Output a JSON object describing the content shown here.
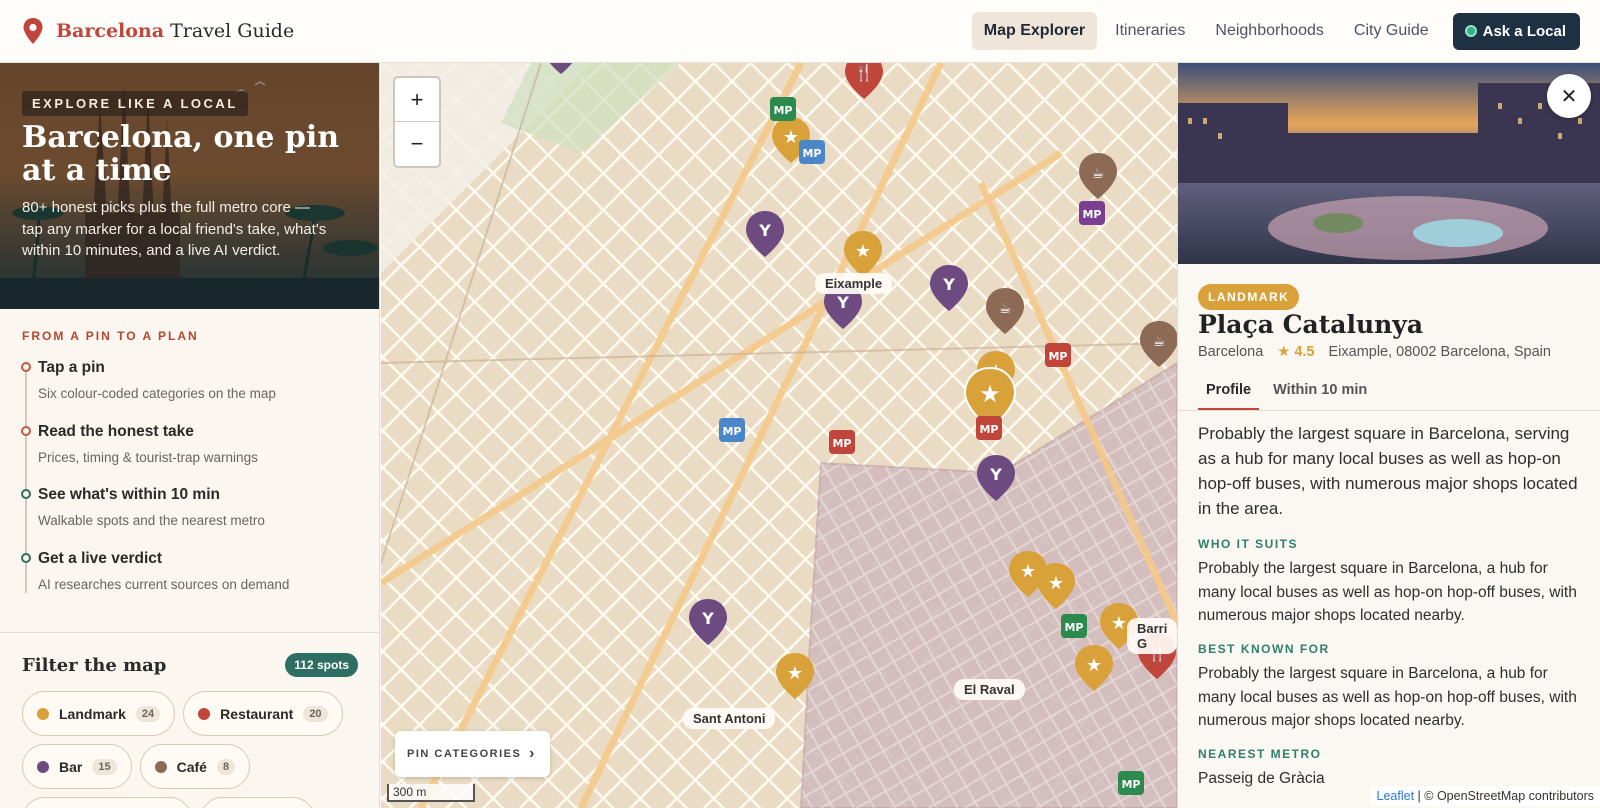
{
  "header": {
    "brand_accent": "Barcelona",
    "brand_rest": "Travel Guide",
    "nav": [
      {
        "label": "Map Explorer",
        "active": true
      },
      {
        "label": "Itineraries",
        "active": false
      },
      {
        "label": "Neighborhoods",
        "active": false
      },
      {
        "label": "City Guide",
        "active": false
      }
    ],
    "cta": "Ask a Local"
  },
  "hero": {
    "badge": "EXPLORE LIKE A LOCAL",
    "title": "Barcelona, one pin at a time",
    "subtitle": "80+ honest picks plus the full metro core — tap any marker for a local friend's take, what's within 10 minutes, and a live AI verdict."
  },
  "steps": {
    "heading": "FROM A PIN TO A PLAN",
    "items": [
      {
        "title": "Tap a pin",
        "desc": "Six colour-coded categories on the map"
      },
      {
        "title": "Read the honest take",
        "desc": "Prices, timing & tourist-trap warnings"
      },
      {
        "title": "See what's within 10 min",
        "desc": "Walkable spots and the nearest metro"
      },
      {
        "title": "Get a live verdict",
        "desc": "AI researches current sources on demand"
      }
    ]
  },
  "filter": {
    "title": "Filter the map",
    "count_badge": "112 spots",
    "chips": [
      {
        "label": "Landmark",
        "count": "24",
        "color": "#d8a13a"
      },
      {
        "label": "Restaurant",
        "count": "20",
        "color": "#c0453a"
      },
      {
        "label": "Bar",
        "count": "15",
        "color": "#6d4a80"
      },
      {
        "label": "Café",
        "count": "8",
        "color": "#8c6a55"
      }
    ]
  },
  "map": {
    "zoom_in": "+",
    "zoom_out": "−",
    "labels": [
      "Eixample",
      "El Raval",
      "Sant Antoni",
      "Barri G"
    ],
    "pin_categories": "PIN CATEGORIES",
    "scale": "300 m",
    "attribution_leaflet": "Leaflet",
    "attribution_osm": "© OpenStreetMap contributors"
  },
  "detail": {
    "category": "LANDMARK",
    "title": "Plaça Catalunya",
    "city": "Barcelona",
    "rating": "★ 4.5",
    "address": "Eixample, 08002 Barcelona, Spain",
    "tabs": [
      "Profile",
      "Within 10 min"
    ],
    "description": "Probably the largest square in Barcelona, serving as a hub for many local buses as well as hop-on hop-off buses, with numerous major shops located in the area.",
    "who_head": "WHO IT SUITS",
    "who_body": "Probably the largest square in Barcelona, a hub for many local buses as well as hop-on hop-off buses, with numerous major shops located nearby.",
    "best_head": "BEST KNOWN FOR",
    "best_body": "Probably the largest square in Barcelona, a hub for many local buses as well as hop-on hop-off buses, with numerous major shops located nearby.",
    "metro_head": "NEAREST METRO",
    "metro_body": "Passeig de Gràcia"
  }
}
